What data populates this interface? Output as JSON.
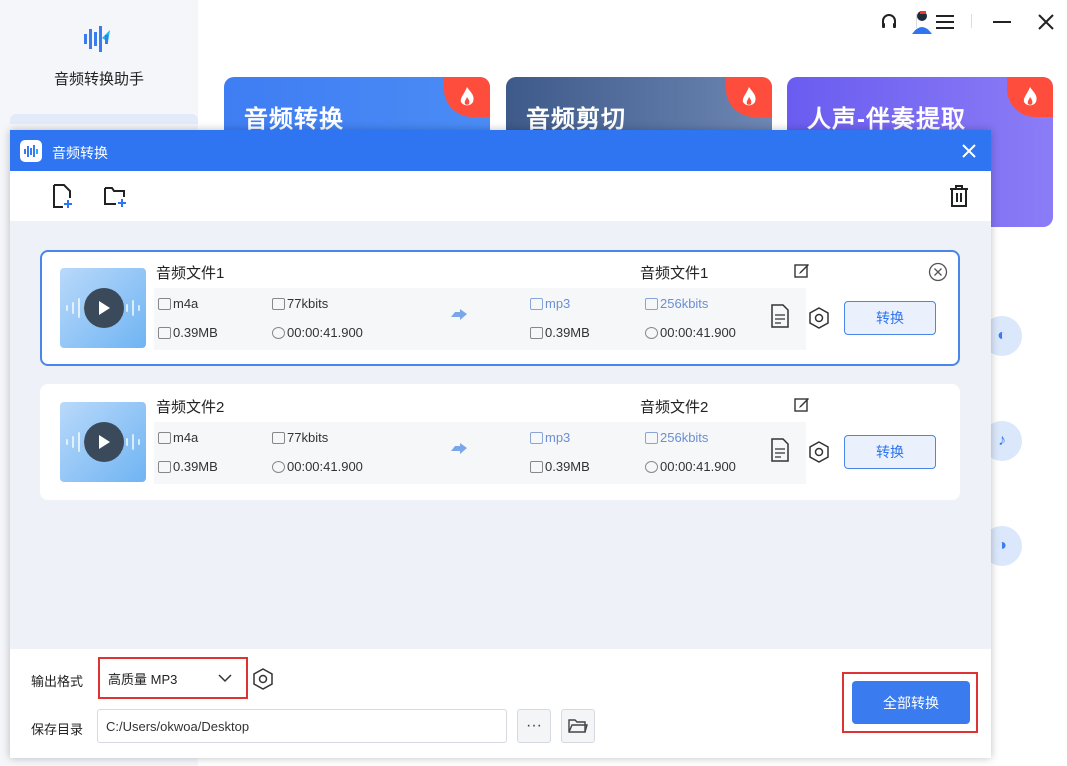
{
  "app": {
    "name": "音频转换助手",
    "cards": [
      {
        "title": "音频转换",
        "color_from": "#3f7df3",
        "color_to": "#4a8cf5"
      },
      {
        "title": "音频剪切",
        "color_from": "#3e5a8a",
        "color_to": "#6d86b3"
      },
      {
        "title": "人声-伴奏提取",
        "color_from": "#6a5cf0",
        "color_to": "#8b7cf6"
      }
    ]
  },
  "dialog": {
    "title": "音频转换",
    "files": [
      {
        "source_name": "音频文件1",
        "source_format": "m4a",
        "source_bitrate": "77kbits",
        "source_size": "0.39MB",
        "source_duration": "00:00:41.900",
        "target_name": "音频文件1",
        "target_format": "mp3",
        "target_bitrate": "256kbits",
        "target_size": "0.39MB",
        "target_duration": "00:00:41.900",
        "convert_label": "转换"
      },
      {
        "source_name": "音频文件2",
        "source_format": "m4a",
        "source_bitrate": "77kbits",
        "source_size": "0.39MB",
        "source_duration": "00:00:41.900",
        "target_name": "音频文件2",
        "target_format": "mp3",
        "target_bitrate": "256kbits",
        "target_size": "0.39MB",
        "target_duration": "00:00:41.900",
        "convert_label": "转换"
      }
    ],
    "footer": {
      "format_label": "输出格式",
      "format_value": "高质量 MP3",
      "dir_label": "保存目录",
      "dir_value": "C:/Users/okwoa/Desktop",
      "more_label": "···",
      "convert_all_label": "全部转换"
    }
  },
  "colors": {
    "accent": "#2f74f0",
    "highlight_border": "#dd3333"
  }
}
